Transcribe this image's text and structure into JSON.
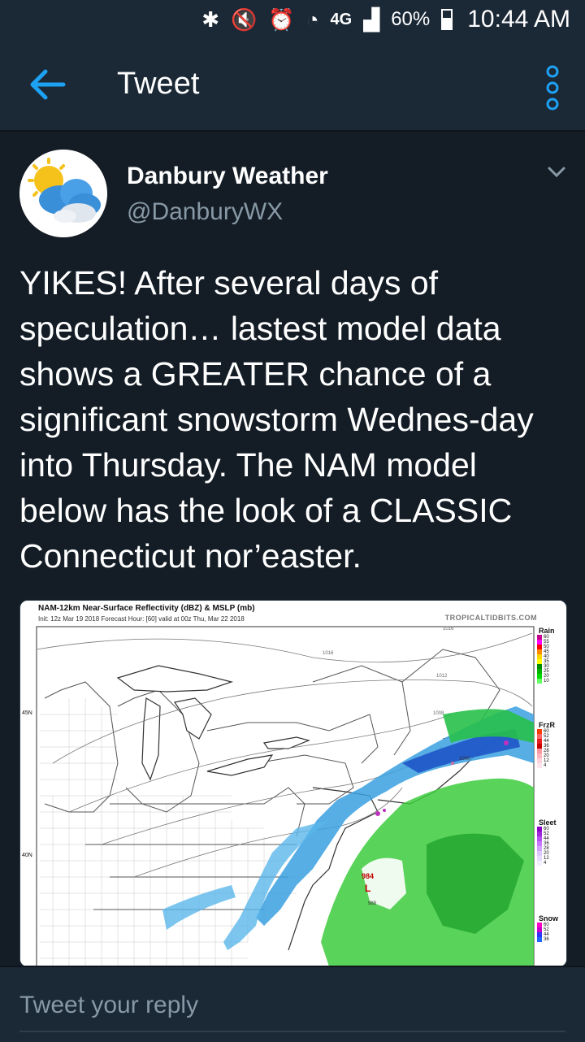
{
  "status_bar": {
    "network": "4G",
    "battery": "60%",
    "time": "10:44 AM"
  },
  "app_bar": {
    "title": "Tweet"
  },
  "tweet": {
    "author_name": "Danbury Weather",
    "author_handle": "@DanburyWX",
    "text": "YIKES! After several days of speculation… lastest model data shows a GREATER chance of a significant snowstorm Wednes-day into Thursday. The NAM model below has the look of a CLASSIC Connecticut nor’easter."
  },
  "media": {
    "title": "NAM-12km Near-Surface Reflectivity (dBZ) & MSLP (mb)",
    "subtitle": "Init: 12z Mar 19 2018   Forecast Hour: [60]   valid at 00z Thu, Mar 22 2018",
    "credit": "TROPICALTIDBITS.COM",
    "lat_45": "45N",
    "lat_40": "40N",
    "low_pressure_value": "984",
    "low_pressure_letter": "L",
    "isobars": [
      "1016",
      "1016",
      "1012",
      "1008",
      "1000",
      "988"
    ],
    "legend": {
      "rain": {
        "title": "Rain",
        "values": [
          "60",
          "55",
          "50",
          "45",
          "40",
          "35",
          "30",
          "25",
          "20",
          "10"
        ]
      },
      "frzr": {
        "title": "FrzR",
        "values": [
          "60",
          "52",
          "44",
          "36",
          "28",
          "20",
          "12",
          "4"
        ]
      },
      "sleet": {
        "title": "Sleet",
        "values": [
          "60",
          "52",
          "44",
          "36",
          "28",
          "20",
          "12",
          "4"
        ]
      },
      "snow": {
        "title": "Snow",
        "values": [
          "60",
          "52",
          "44",
          "36"
        ]
      }
    }
  },
  "reply": {
    "placeholder": "Tweet your reply"
  },
  "colors": {
    "background": "#141d26",
    "bar": "#1b2836",
    "accent": "#1da1f2",
    "secondary_text": "#8899a6"
  }
}
